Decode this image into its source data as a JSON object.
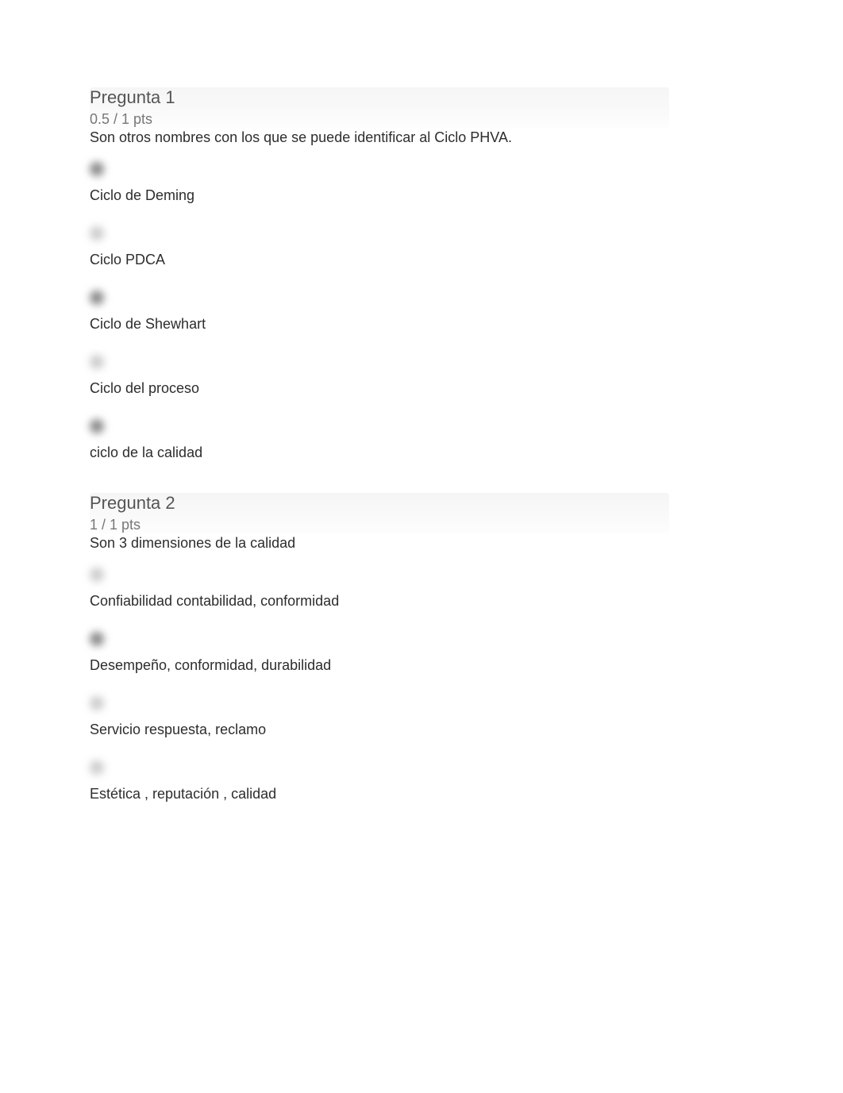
{
  "questions": [
    {
      "title": "Pregunta 1",
      "points": "0.5 / 1 pts",
      "text": "Son otros nombres con los que se puede identificar al Ciclo PHVA.",
      "options": [
        {
          "label": "Ciclo de Deming",
          "shade": "dark"
        },
        {
          "label": "Ciclo PDCA",
          "shade": "light"
        },
        {
          "label": "Ciclo de Shewhart",
          "shade": "dark"
        },
        {
          "label": "Ciclo del proceso",
          "shade": "light"
        },
        {
          "label": "ciclo de la calidad",
          "shade": "dark"
        }
      ]
    },
    {
      "title": "Pregunta 2",
      "points": "1 / 1 pts",
      "text": "Son 3 dimensiones de la calidad",
      "options": [
        {
          "label": "Confiabilidad contabilidad, conformidad",
          "shade": "light"
        },
        {
          "label": "Desempeño, conformidad, durabilidad",
          "shade": "dark"
        },
        {
          "label": "Servicio respuesta, reclamo",
          "shade": "light"
        },
        {
          "label": "Estética , reputación , calidad",
          "shade": "light"
        }
      ]
    }
  ]
}
